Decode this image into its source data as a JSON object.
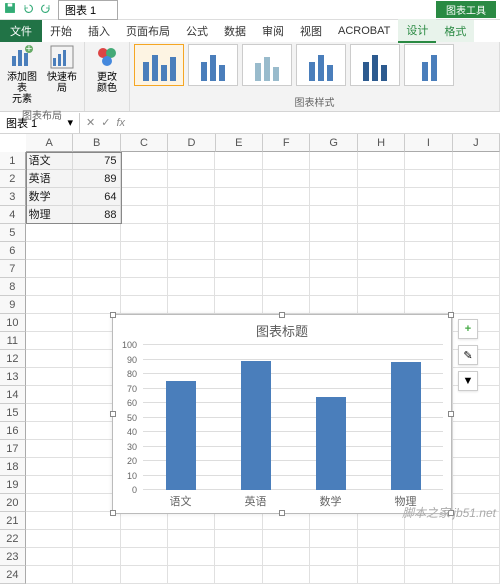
{
  "qat": {
    "chart_name": "图表 1"
  },
  "context_tab_group": "图表工具",
  "tabs": {
    "file": "文件",
    "home": "开始",
    "insert": "插入",
    "page": "页面布局",
    "formula": "公式",
    "data": "数据",
    "review": "审阅",
    "view": "视图",
    "acrobat": "ACROBAT",
    "design": "设计",
    "format": "格式"
  },
  "ribbon": {
    "layout_group": "图表布局",
    "add_element": "添加图表\n元素",
    "quick_layout": "快速布局",
    "change_colors": "更改\n颜色",
    "styles_group": "图表样式"
  },
  "fx_label": "fx",
  "namebox_value": "图表 1",
  "columns": [
    "A",
    "B",
    "C",
    "D",
    "E",
    "F",
    "G",
    "H",
    "I",
    "J"
  ],
  "rows": [
    "1",
    "2",
    "3",
    "4",
    "5",
    "6",
    "7",
    "8",
    "9",
    "10",
    "11",
    "12",
    "13",
    "14",
    "15",
    "16",
    "17",
    "18",
    "19",
    "20",
    "21",
    "22",
    "23",
    "24"
  ],
  "sheet": {
    "A1": "语文",
    "B1": "75",
    "A2": "英语",
    "B2": "89",
    "A3": "数学",
    "B3": "64",
    "A4": "物理",
    "B4": "88"
  },
  "chart_data": {
    "type": "bar",
    "title": "图表标题",
    "categories": [
      "语文",
      "英语",
      "数学",
      "物理"
    ],
    "values": [
      75,
      89,
      64,
      88
    ],
    "ylim": [
      0,
      100
    ],
    "yticks": [
      0,
      10,
      20,
      30,
      40,
      50,
      60,
      70,
      80,
      90,
      100
    ],
    "xlabel": "",
    "ylabel": ""
  },
  "watermark": "脚本之家 jb51.net"
}
